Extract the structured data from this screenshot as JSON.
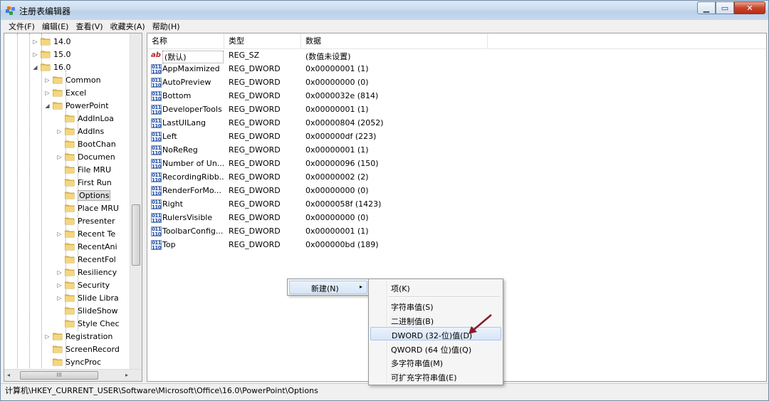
{
  "window": {
    "title": "注册表编辑器"
  },
  "menubar": [
    "文件(F)",
    "编辑(E)",
    "查看(V)",
    "收藏夹(A)",
    "帮助(H)"
  ],
  "tree": {
    "items": [
      {
        "label": "14.0",
        "expander": "▷"
      },
      {
        "label": "15.0",
        "expander": "▷"
      },
      {
        "label": "16.0",
        "expander": "◢"
      },
      {
        "label": "Common",
        "expander": "▷"
      },
      {
        "label": "Excel",
        "expander": "▷"
      },
      {
        "label": "PowerPoint",
        "expander": "◢"
      },
      {
        "label": "AddInLoa",
        "expander": ""
      },
      {
        "label": "AddIns",
        "expander": "▷"
      },
      {
        "label": "BootChan",
        "expander": ""
      },
      {
        "label": "Documen",
        "expander": "▷"
      },
      {
        "label": "File MRU",
        "expander": ""
      },
      {
        "label": "First Run",
        "expander": ""
      },
      {
        "label": "Options",
        "expander": "",
        "selected": true
      },
      {
        "label": "Place MRU",
        "expander": ""
      },
      {
        "label": "Presenter",
        "expander": ""
      },
      {
        "label": "Recent Te",
        "expander": "▷"
      },
      {
        "label": "RecentAni",
        "expander": ""
      },
      {
        "label": "RecentFol",
        "expander": ""
      },
      {
        "label": "Resiliency",
        "expander": "▷"
      },
      {
        "label": "Security",
        "expander": "▷"
      },
      {
        "label": "Slide Libra",
        "expander": "▷"
      },
      {
        "label": "SlideShow",
        "expander": ""
      },
      {
        "label": "Style Chec",
        "expander": ""
      },
      {
        "label": "Registration",
        "expander": "▷"
      },
      {
        "label": "ScreenRecord",
        "expander": ""
      },
      {
        "label": "SyncProc",
        "expander": ""
      }
    ],
    "scroll_left": "◂",
    "scroll_right": "▸",
    "scroll_thumb_grip": "III"
  },
  "list": {
    "columns": [
      "名称",
      "类型",
      "数据"
    ],
    "rows": [
      {
        "icon": "string-value-icon",
        "name": "(默认)",
        "type": "REG_SZ",
        "data": "(数值未设置)"
      },
      {
        "icon": "dword-value-icon",
        "name": "AppMaximized",
        "type": "REG_DWORD",
        "data": "0x00000001 (1)"
      },
      {
        "icon": "dword-value-icon",
        "name": "AutoPreview",
        "type": "REG_DWORD",
        "data": "0x00000000 (0)"
      },
      {
        "icon": "dword-value-icon",
        "name": "Bottom",
        "type": "REG_DWORD",
        "data": "0x0000032e (814)"
      },
      {
        "icon": "dword-value-icon",
        "name": "DeveloperTools",
        "type": "REG_DWORD",
        "data": "0x00000001 (1)"
      },
      {
        "icon": "dword-value-icon",
        "name": "LastUILang",
        "type": "REG_DWORD",
        "data": "0x00000804 (2052)"
      },
      {
        "icon": "dword-value-icon",
        "name": "Left",
        "type": "REG_DWORD",
        "data": "0x000000df (223)"
      },
      {
        "icon": "dword-value-icon",
        "name": "NoReReg",
        "type": "REG_DWORD",
        "data": "0x00000001 (1)"
      },
      {
        "icon": "dword-value-icon",
        "name": "Number of Un...",
        "type": "REG_DWORD",
        "data": "0x00000096 (150)"
      },
      {
        "icon": "dword-value-icon",
        "name": "RecordingRibb...",
        "type": "REG_DWORD",
        "data": "0x00000002 (2)"
      },
      {
        "icon": "dword-value-icon",
        "name": "RenderForMo...",
        "type": "REG_DWORD",
        "data": "0x00000000 (0)"
      },
      {
        "icon": "dword-value-icon",
        "name": "Right",
        "type": "REG_DWORD",
        "data": "0x0000058f (1423)"
      },
      {
        "icon": "dword-value-icon",
        "name": "RulersVisible",
        "type": "REG_DWORD",
        "data": "0x00000000 (0)"
      },
      {
        "icon": "dword-value-icon",
        "name": "ToolbarConfig...",
        "type": "REG_DWORD",
        "data": "0x00000001 (1)"
      },
      {
        "icon": "dword-value-icon",
        "name": "Top",
        "type": "REG_DWORD",
        "data": "0x000000bd (189)"
      }
    ]
  },
  "context_menu": {
    "new_label": "新建(N)",
    "arrow": "▸",
    "submenu": [
      {
        "label": "项(K)"
      },
      {
        "label": "字符串值(S)"
      },
      {
        "label": "二进制值(B)"
      },
      {
        "label": "DWORD (32-位)值(D)",
        "highlighted": true
      },
      {
        "label": "QWORD (64 位)值(Q)"
      },
      {
        "label": "多字符串值(M)"
      },
      {
        "label": "可扩充字符串值(E)"
      }
    ]
  },
  "statusbar": {
    "path": "计算机\\HKEY_CURRENT_USER\\Software\\Microsoft\\Office\\16.0\\PowerPoint\\Options"
  },
  "colors": {
    "annotation_arrow": "#8b1a2b",
    "selection": "#d6e6f7"
  }
}
